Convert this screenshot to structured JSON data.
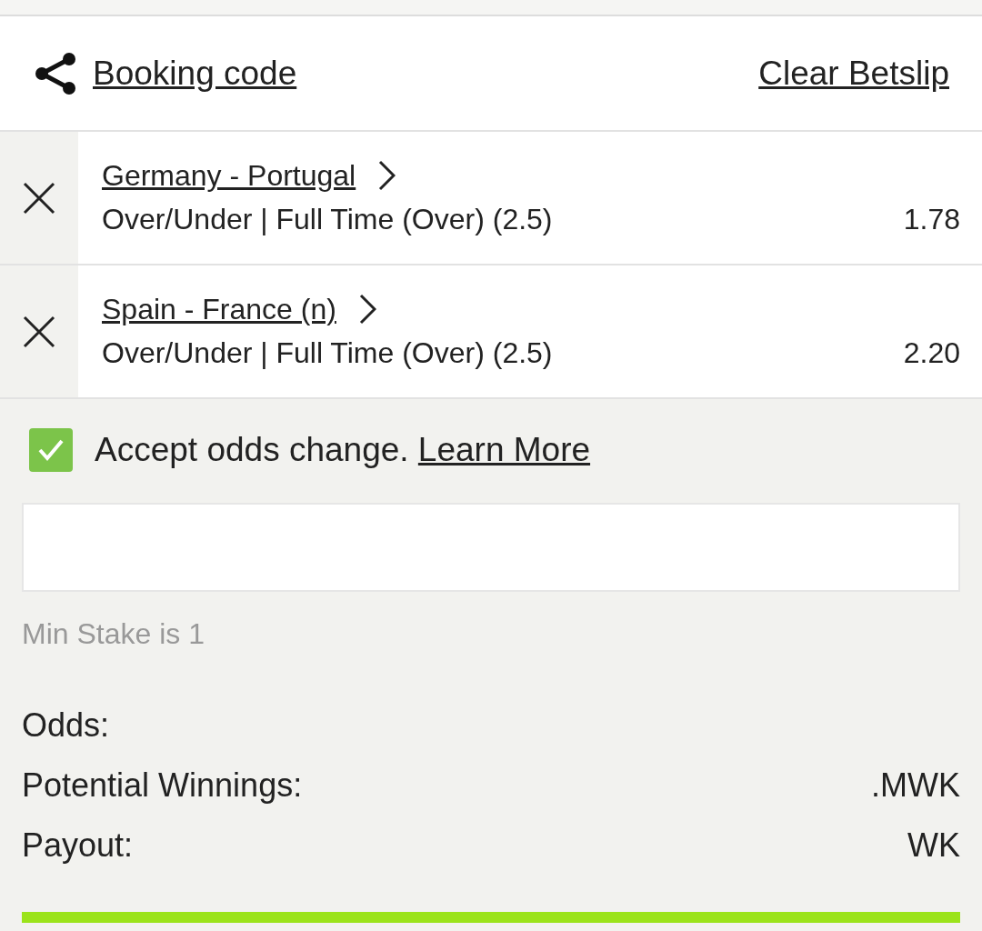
{
  "header": {
    "booking_code": "Booking code",
    "clear": "Clear Betslip"
  },
  "selections": [
    {
      "match": "Germany - Portugal",
      "market": "Over/Under | Full Time (Over) (2.5)",
      "odds": "1.78"
    },
    {
      "match": "Spain - France (n)",
      "market": "Over/Under | Full Time (Over) (2.5)",
      "odds": "2.20"
    }
  ],
  "accept_odds": {
    "checked": true,
    "label": "Accept odds change.",
    "link": "Learn More"
  },
  "stake": {
    "hint": "Min Stake is 1"
  },
  "summary": [
    {
      "label": "Odds:"
    },
    {
      "label": "Potential Winnings:",
      "value": ".MWK"
    },
    {
      "label": "Payout:",
      "value": "WK"
    }
  ]
}
